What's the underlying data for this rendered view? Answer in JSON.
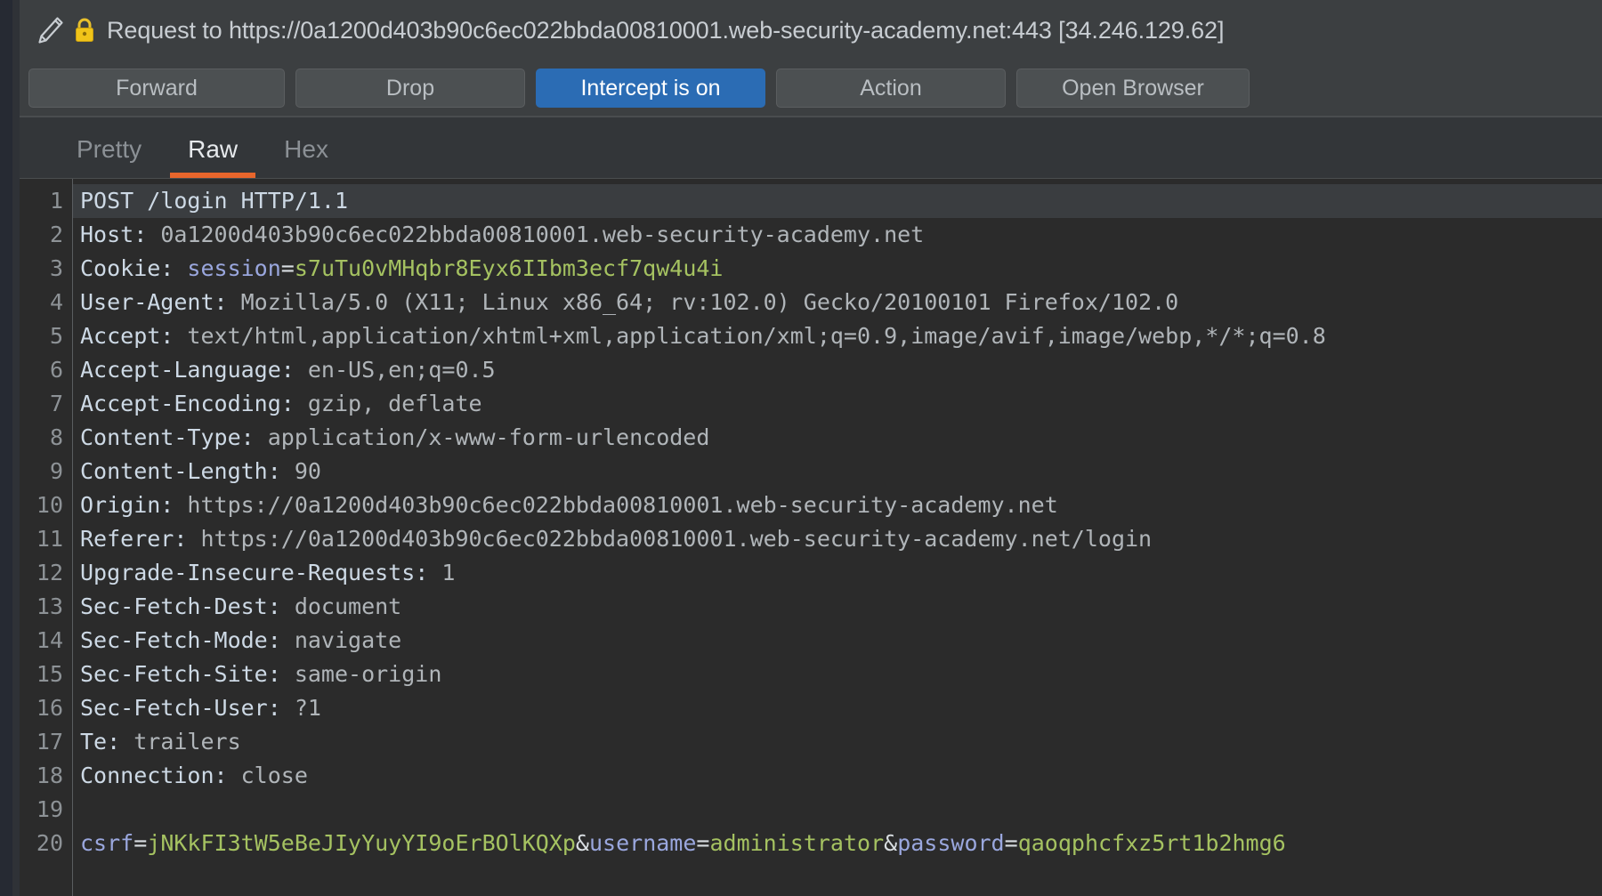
{
  "window": {
    "title": "Request to https://0a1200d403b90c6ec022bbda00810001.web-security-academy.net:443 [34.246.129.62]",
    "pencil_icon": "pencil-icon",
    "lock_icon": "lock-icon"
  },
  "colors": {
    "accent_orange": "#e8662c",
    "intercept_blue": "#2b6cb4",
    "panel_bg": "#3c3f41",
    "editor_bg": "#2b2b2b",
    "string_green": "#a5c261",
    "param_blue": "#9aa7de",
    "header_name": "#cdd9e5"
  },
  "toolbar": {
    "forward_label": "Forward",
    "drop_label": "Drop",
    "intercept_label": "Intercept is on",
    "action_label": "Action",
    "open_browser_label": "Open Browser"
  },
  "view_tabs": [
    {
      "label": "Pretty",
      "active": false
    },
    {
      "label": "Raw",
      "active": true
    },
    {
      "label": "Hex",
      "active": false
    }
  ],
  "editor": {
    "line_numbers": [
      "1",
      "2",
      "3",
      "4",
      "5",
      "6",
      "7",
      "8",
      "9",
      "10",
      "11",
      "12",
      "13",
      "14",
      "15",
      "16",
      "17",
      "18",
      "19",
      "20"
    ],
    "lines": [
      {
        "n": 1,
        "highlight": true,
        "tokens": [
          {
            "t": "POST /login HTTP/1.1",
            "c": "tok-hdr"
          }
        ]
      },
      {
        "n": 2,
        "highlight": false,
        "tokens": [
          {
            "t": "Host: ",
            "c": "tok-hdr"
          },
          {
            "t": "0a1200d403b90c6ec022bbda00810001.web-security-academy.net",
            "c": "tok-val"
          }
        ]
      },
      {
        "n": 3,
        "highlight": false,
        "tokens": [
          {
            "t": "Cookie: ",
            "c": "tok-hdr"
          },
          {
            "t": "session",
            "c": "tok-name"
          },
          {
            "t": "=",
            "c": "tok-punct"
          },
          {
            "t": "s7uTu0vMHqbr8Eyx6IIbm3ecf7qw4u4i",
            "c": "tok-str"
          }
        ]
      },
      {
        "n": 4,
        "highlight": false,
        "tokens": [
          {
            "t": "User-Agent: ",
            "c": "tok-hdr"
          },
          {
            "t": "Mozilla/5.0 (X11; Linux x86_64; rv:102.0) Gecko/20100101 Firefox/102.0",
            "c": "tok-val"
          }
        ]
      },
      {
        "n": 5,
        "highlight": false,
        "tokens": [
          {
            "t": "Accept: ",
            "c": "tok-hdr"
          },
          {
            "t": "text/html,application/xhtml+xml,application/xml;q=0.9,image/avif,image/webp,*/*;q=0.8",
            "c": "tok-val"
          }
        ]
      },
      {
        "n": 6,
        "highlight": false,
        "tokens": [
          {
            "t": "Accept-Language: ",
            "c": "tok-hdr"
          },
          {
            "t": "en-US,en;q=0.5",
            "c": "tok-val"
          }
        ]
      },
      {
        "n": 7,
        "highlight": false,
        "tokens": [
          {
            "t": "Accept-Encoding: ",
            "c": "tok-hdr"
          },
          {
            "t": "gzip, deflate",
            "c": "tok-val"
          }
        ]
      },
      {
        "n": 8,
        "highlight": false,
        "tokens": [
          {
            "t": "Content-Type: ",
            "c": "tok-hdr"
          },
          {
            "t": "application/x-www-form-urlencoded",
            "c": "tok-val"
          }
        ]
      },
      {
        "n": 9,
        "highlight": false,
        "tokens": [
          {
            "t": "Content-Length: ",
            "c": "tok-hdr"
          },
          {
            "t": "90",
            "c": "tok-val"
          }
        ]
      },
      {
        "n": 10,
        "highlight": false,
        "tokens": [
          {
            "t": "Origin: ",
            "c": "tok-hdr"
          },
          {
            "t": "https://0a1200d403b90c6ec022bbda00810001.web-security-academy.net",
            "c": "tok-val"
          }
        ]
      },
      {
        "n": 11,
        "highlight": false,
        "tokens": [
          {
            "t": "Referer: ",
            "c": "tok-hdr"
          },
          {
            "t": "https://0a1200d403b90c6ec022bbda00810001.web-security-academy.net/login",
            "c": "tok-val"
          }
        ]
      },
      {
        "n": 12,
        "highlight": false,
        "tokens": [
          {
            "t": "Upgrade-Insecure-Requests: ",
            "c": "tok-hdr"
          },
          {
            "t": "1",
            "c": "tok-val"
          }
        ]
      },
      {
        "n": 13,
        "highlight": false,
        "tokens": [
          {
            "t": "Sec-Fetch-Dest: ",
            "c": "tok-hdr"
          },
          {
            "t": "document",
            "c": "tok-val"
          }
        ]
      },
      {
        "n": 14,
        "highlight": false,
        "tokens": [
          {
            "t": "Sec-Fetch-Mode: ",
            "c": "tok-hdr"
          },
          {
            "t": "navigate",
            "c": "tok-val"
          }
        ]
      },
      {
        "n": 15,
        "highlight": false,
        "tokens": [
          {
            "t": "Sec-Fetch-Site: ",
            "c": "tok-hdr"
          },
          {
            "t": "same-origin",
            "c": "tok-val"
          }
        ]
      },
      {
        "n": 16,
        "highlight": false,
        "tokens": [
          {
            "t": "Sec-Fetch-User: ",
            "c": "tok-hdr"
          },
          {
            "t": "?1",
            "c": "tok-val"
          }
        ]
      },
      {
        "n": 17,
        "highlight": false,
        "tokens": [
          {
            "t": "Te: ",
            "c": "tok-hdr"
          },
          {
            "t": "trailers",
            "c": "tok-val"
          }
        ]
      },
      {
        "n": 18,
        "highlight": false,
        "tokens": [
          {
            "t": "Connection: ",
            "c": "tok-hdr"
          },
          {
            "t": "close",
            "c": "tok-val"
          }
        ]
      },
      {
        "n": 19,
        "highlight": false,
        "tokens": [
          {
            "t": "",
            "c": "tok-val"
          }
        ]
      },
      {
        "n": 20,
        "highlight": false,
        "tokens": [
          {
            "t": "csrf",
            "c": "tok-name"
          },
          {
            "t": "=",
            "c": "tok-punct"
          },
          {
            "t": "jNKkFI3tW5eBeJIyYuyYI9oErBOlKQXp",
            "c": "tok-str"
          },
          {
            "t": "&",
            "c": "tok-punct"
          },
          {
            "t": "username",
            "c": "tok-name"
          },
          {
            "t": "=",
            "c": "tok-punct"
          },
          {
            "t": "administrator",
            "c": "tok-str"
          },
          {
            "t": "&",
            "c": "tok-punct"
          },
          {
            "t": "password",
            "c": "tok-name"
          },
          {
            "t": "=",
            "c": "tok-punct"
          },
          {
            "t": "qaoqphcfxz5rt1b2hmg6",
            "c": "tok-str"
          }
        ]
      }
    ]
  }
}
